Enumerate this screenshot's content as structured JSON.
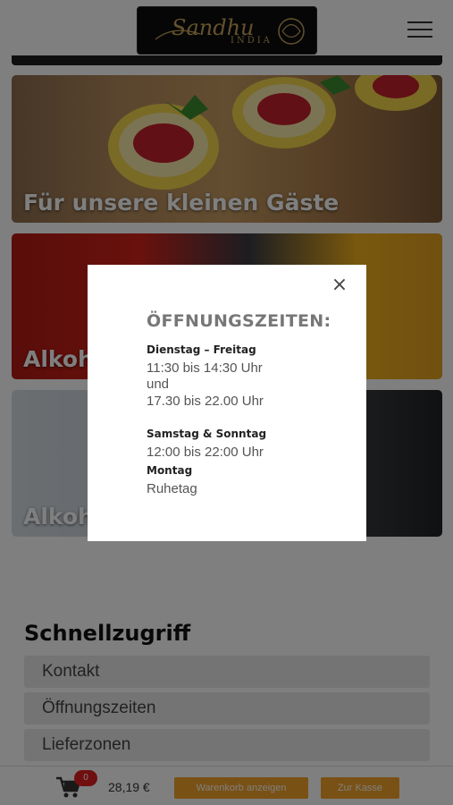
{
  "header": {
    "logo_script": "Sandhu",
    "logo_sub": "INDIA"
  },
  "categories": [
    {
      "title": "Für unsere kleinen Gäste"
    },
    {
      "title": "Alkoholfreie Getränke"
    },
    {
      "title": "Alkoholische Getränke"
    }
  ],
  "quick_access": {
    "title": "Schnellzugriff",
    "items": [
      "Kontakt",
      "Öffnungszeiten",
      "Lieferzonen"
    ]
  },
  "cart": {
    "count": "0",
    "total": "28,19 €",
    "view_cart_label": "Warenkorb anzeigen",
    "checkout_label": "Zur Kasse"
  },
  "modal": {
    "close_label": "×",
    "heading": "ÖFFNUNGSZEITEN:",
    "blocks": {
      "weekday_label": "Dienstag – Freitag",
      "weekday_time1": "11:30 bis 14:30 Uhr",
      "weekday_and": "und",
      "weekday_time2": "17.30 bis 22.00 Uhr",
      "weekend_label": "Samstag & Sonntag",
      "weekend_time": "12:00 bis 22:00 Uhr",
      "monday_label": "Montag",
      "monday_text": "Ruhetag"
    }
  },
  "colors": {
    "accent": "#f3a22b",
    "badge": "#e01e1e",
    "logo_gold": "#c9a45a"
  }
}
